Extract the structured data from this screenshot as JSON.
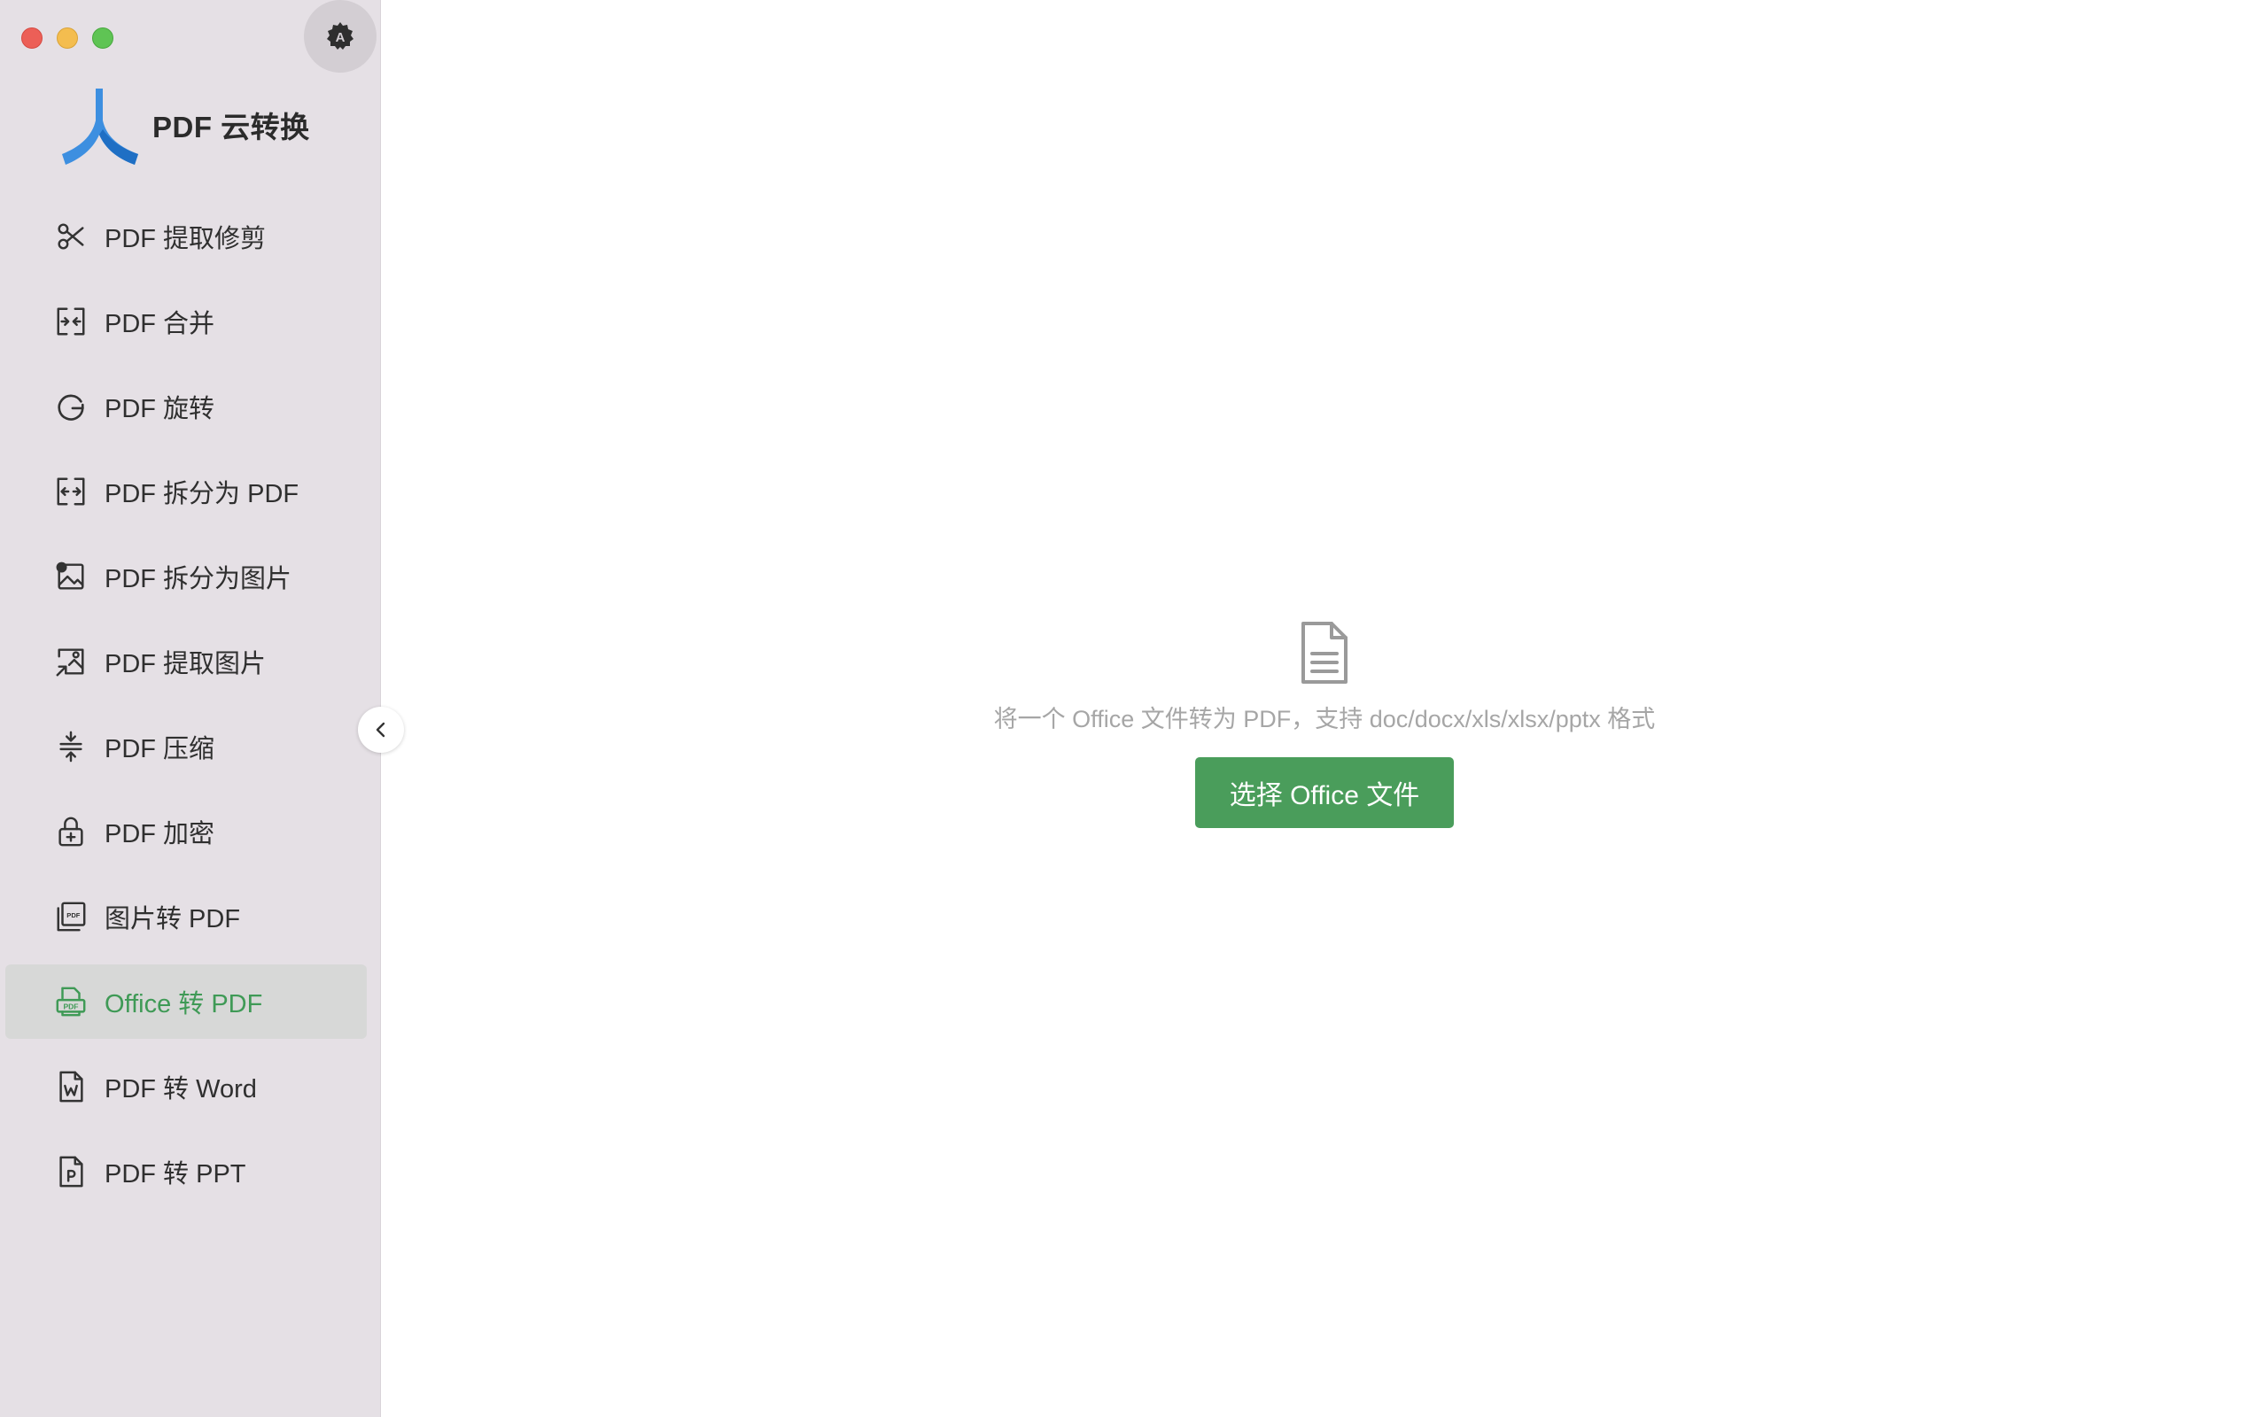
{
  "app": {
    "title": "PDF 云转换"
  },
  "window_controls": {
    "close": "close",
    "minimize": "minimize",
    "maximize": "maximize"
  },
  "theme_button_icon": "theme-auto-icon",
  "sidebar": {
    "items": [
      {
        "label": "PDF 提取修剪",
        "icon": "scissors-icon"
      },
      {
        "label": "PDF 合并",
        "icon": "merge-icon"
      },
      {
        "label": "PDF 旋转",
        "icon": "rotate-icon"
      },
      {
        "label": "PDF 拆分为 PDF",
        "icon": "split-icon"
      },
      {
        "label": "PDF 拆分为图片",
        "icon": "split-image-icon"
      },
      {
        "label": "PDF 提取图片",
        "icon": "extract-image-icon"
      },
      {
        "label": "PDF 压缩",
        "icon": "compress-icon"
      },
      {
        "label": "PDF 加密",
        "icon": "lock-icon"
      },
      {
        "label": "图片转 PDF",
        "icon": "image-to-pdf-icon"
      },
      {
        "label": "Office 转 PDF",
        "icon": "office-to-pdf-icon",
        "active": true
      },
      {
        "label": "PDF 转 Word",
        "icon": "word-doc-icon"
      },
      {
        "label": "PDF 转 PPT",
        "icon": "ppt-doc-icon"
      }
    ],
    "active_color": "#3f9a56"
  },
  "main": {
    "hint": "将一个 Office 文件转为 PDF，支持 doc/docx/xls/xlsx/pptx 格式",
    "select_button": "选择 Office 文件",
    "button_color": "#4a9d5b"
  }
}
